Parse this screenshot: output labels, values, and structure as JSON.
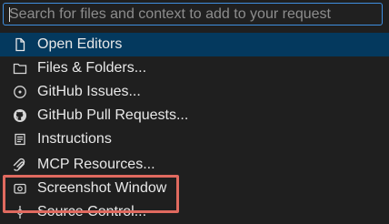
{
  "search": {
    "placeholder": "Search for files and context to add to your request",
    "value": ""
  },
  "items": [
    {
      "label": "Open Editors",
      "icon": "file-icon",
      "selected": true
    },
    {
      "label": "Files & Folders...",
      "icon": "folder-icon"
    },
    {
      "label": "GitHub Issues...",
      "icon": "issue-icon"
    },
    {
      "label": "GitHub Pull Requests...",
      "icon": "github-icon"
    },
    {
      "label": "Instructions",
      "icon": "instructions-icon"
    },
    {
      "label": "MCP Resources...",
      "icon": "mcp-icon",
      "highlighted": true
    },
    {
      "label": "Screenshot Window",
      "icon": "screenshot-icon"
    },
    {
      "label": "Source Control...",
      "icon": "source-control-icon"
    }
  ],
  "colors": {
    "background": "#1f1f1f",
    "selection": "#04395e",
    "focus_border": "#3f8fe0",
    "highlight_box": "#e06a5f"
  }
}
